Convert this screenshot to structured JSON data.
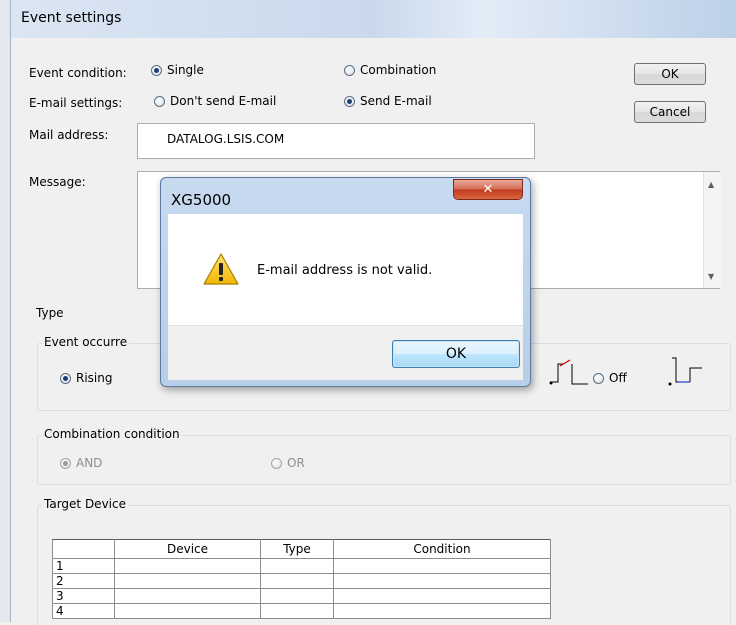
{
  "window": {
    "title": "Event settings"
  },
  "event_condition": {
    "label": "Event condition:",
    "options": [
      {
        "label": "Single",
        "selected": true
      },
      {
        "label": "Combination",
        "selected": false
      }
    ]
  },
  "email_settings": {
    "label": "E-mail settings:",
    "options": [
      {
        "label": "Don't send E-mail",
        "selected": false
      },
      {
        "label": "Send E-mail",
        "selected": true
      }
    ]
  },
  "mail_address": {
    "label": "Mail address:",
    "value": "DATALOG.LSIS.COM"
  },
  "message": {
    "label": "Message:",
    "value": ""
  },
  "buttons": {
    "ok": "OK",
    "cancel": "Cancel"
  },
  "type_section": {
    "label": "Type",
    "event_occurrence": {
      "label": "Event occurre",
      "rising_label": "Rising",
      "off_label": "Off",
      "rising_selected": true
    }
  },
  "combination_condition": {
    "label": "Combination condition",
    "options": [
      {
        "label": "AND",
        "selected": true
      },
      {
        "label": "OR",
        "selected": false
      }
    ]
  },
  "target_device": {
    "label": "Target Device",
    "columns": [
      "",
      "Device",
      "Type",
      "Condition"
    ],
    "rows": [
      "1",
      "2",
      "3",
      "4"
    ]
  },
  "dialog": {
    "title": "XG5000",
    "close_glyph": "✕",
    "message": "E-mail address is not valid.",
    "ok_label": "OK",
    "icon": "warning-icon"
  },
  "colors": {
    "close_button": "#c9452a",
    "dialog_frame": "#b9cfe9",
    "radio_fill": "#1e3c78"
  }
}
